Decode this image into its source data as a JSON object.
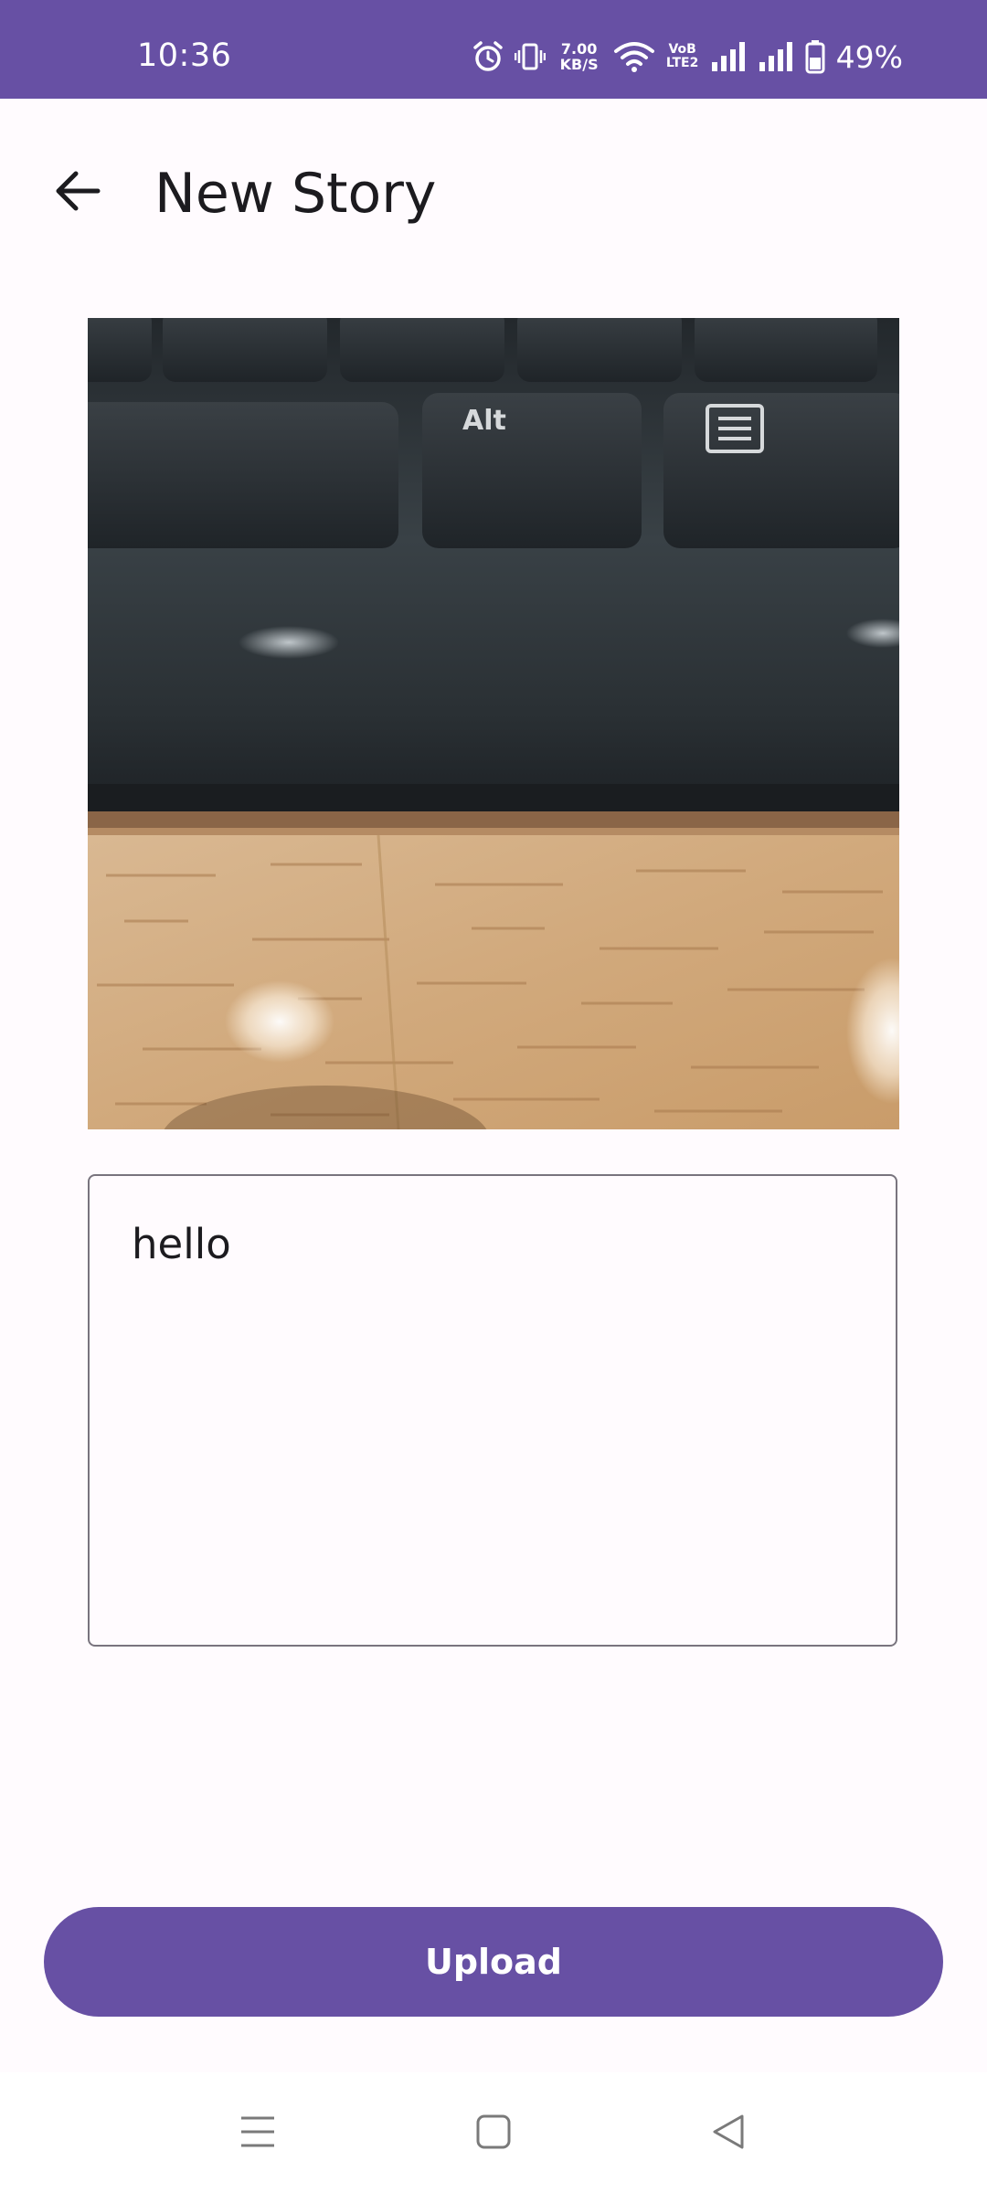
{
  "status_bar": {
    "time": "10:36",
    "net_speed_value": "7.00",
    "net_speed_unit": "KB/S",
    "volte_top": "VoB",
    "volte_bottom": "LTE2",
    "battery_percent": "49%",
    "icons": [
      "alarm-icon",
      "vibrate-icon",
      "wifi-icon",
      "signal-icon",
      "signal-icon",
      "battery-icon"
    ]
  },
  "app_bar": {
    "title": "New Story",
    "back_icon": "arrow-back-icon"
  },
  "story_image": {
    "content": "photo of keyboard edge on wooden desk",
    "key_label": "Alt"
  },
  "caption": {
    "value": "hello"
  },
  "upload_button": {
    "label": "Upload"
  },
  "nav_bar": {
    "items": [
      "menu-icon",
      "home-icon",
      "back-icon"
    ]
  },
  "colors": {
    "primary": "#6750a4",
    "background": "#fffbfe",
    "outline": "#79747e",
    "on_surface": "#1c1b1f"
  }
}
